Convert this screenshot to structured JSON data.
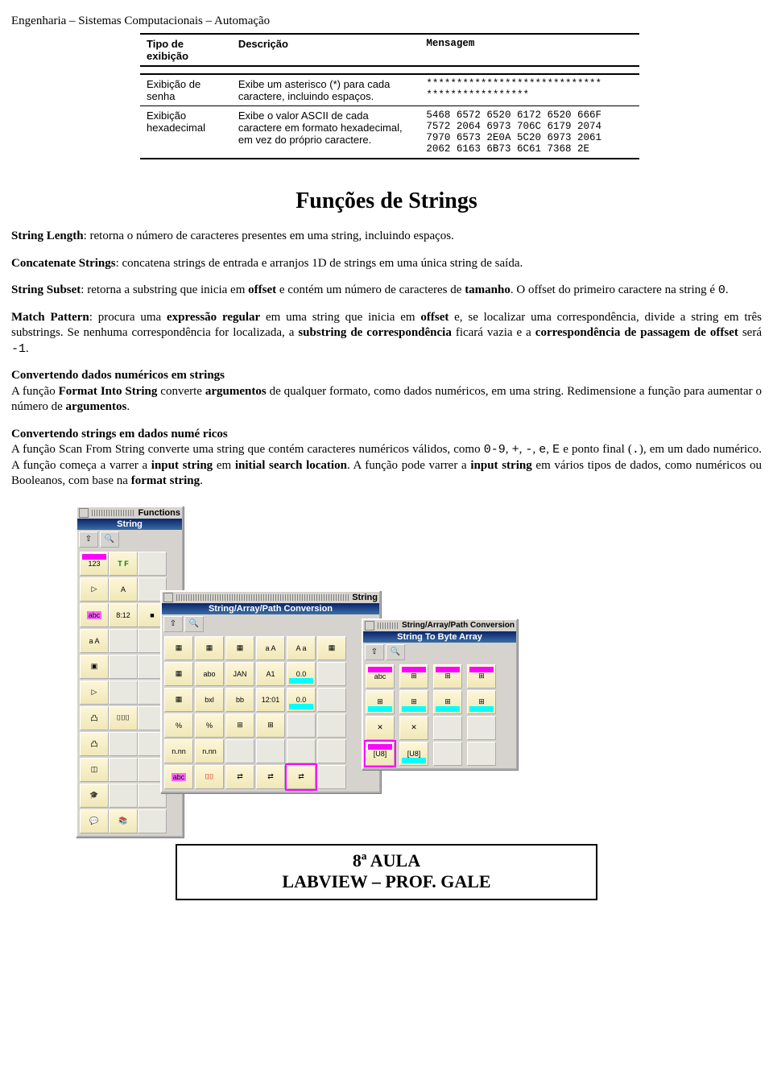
{
  "header": "Engenharia – Sistemas Computacionais – Automação",
  "table": {
    "headers": [
      "Tipo de exibição",
      "Descrição",
      "Mensagem"
    ],
    "rows": [
      {
        "type": "Exibição de senha",
        "desc": "Exibe um asterisco (*) para cada caractere, incluindo espaços.",
        "msg": "*****************************\n*****************"
      },
      {
        "type": "Exibição hexadecimal",
        "desc": "Exibe o valor ASCII de cada caractere em formato hexadecimal, em vez do próprio caractere.",
        "msg": "5468 6572 6520 6172 6520 666F\n7572 2064 6973 706C 6179 2074\n7970 6573 2E0A 5C20 6973 2061\n2062 6163 6B73 6C61 7368 2E"
      }
    ]
  },
  "section_title": "Funções de Strings",
  "paragraphs": {
    "p1a": "String Length",
    "p1b": ": retorna o número de caracteres presentes em uma string, incluindo espaços.",
    "p2a": "Concatenate Strings",
    "p2b": ": concatena strings de entrada e arranjos 1D de strings em uma única string de saída.",
    "p3a": "String Subset",
    "p3b": ": retorna a substring que inicia em ",
    "p3c": "offset",
    "p3d": " e contém um número de caracteres de ",
    "p3e": "tamanho",
    "p3f": ". O offset do primeiro caractere na string é ",
    "p3g": "0",
    "p3h": ".",
    "p4a": "Match Pattern",
    "p4b": ": procura uma ",
    "p4c": "expressão regular",
    "p4d": " em uma string que inicia em ",
    "p4e": "offset",
    "p4f": " e, se localizar uma correspondência, divide a string em três substrings. Se nenhuma correspondência for localizada, a ",
    "p4g": "substring de correspondência",
    "p4h": " ficará vazia e a ",
    "p4i": "correspondência de passagem de offset",
    "p4j": " será ",
    "p4k": "-1",
    "p4l": ".",
    "h5": "Convertendo dados numéricos em strings",
    "p5a": "A função ",
    "p5b": "Format Into String",
    "p5c": " converte ",
    "p5d": "argumentos",
    "p5e": " de qualquer formato, como dados numéricos, em uma string. Redimensione a função para aumentar o número de ",
    "p5f": "argumentos",
    "p5g": ".",
    "h6": "Convertendo strings em dados numé ricos",
    "p6a": "A função Scan From String converte uma string que contém caracteres numéricos válidos, como ",
    "p6b": "0-9",
    "p6c": ", ",
    "p6d": "+",
    "p6e": ", ",
    "p6f": "-",
    "p6g": ", ",
    "p6h": "e",
    "p6i": ", ",
    "p6j": "E",
    "p6k": " e ponto final (",
    "p6l": ".",
    "p6m": "), em um dado numérico. A função começa a varrer a ",
    "p6n": "input string",
    "p6o": " em ",
    "p6p": "initial search location",
    "p6q": ". A função pode varrer a ",
    "p6r": "input string",
    "p6s": " em vários tipos de dados, como numéricos ou Booleanos, com base na ",
    "p6t": "format string",
    "p6u": "."
  },
  "palette_labels": {
    "functions": "Functions",
    "string": "String",
    "sap": "String/Array/Path Conversion",
    "sba": "String To Byte Array"
  },
  "footer": {
    "line1": "8ª AULA",
    "line2": "LABVIEW – PROF. GALE"
  }
}
